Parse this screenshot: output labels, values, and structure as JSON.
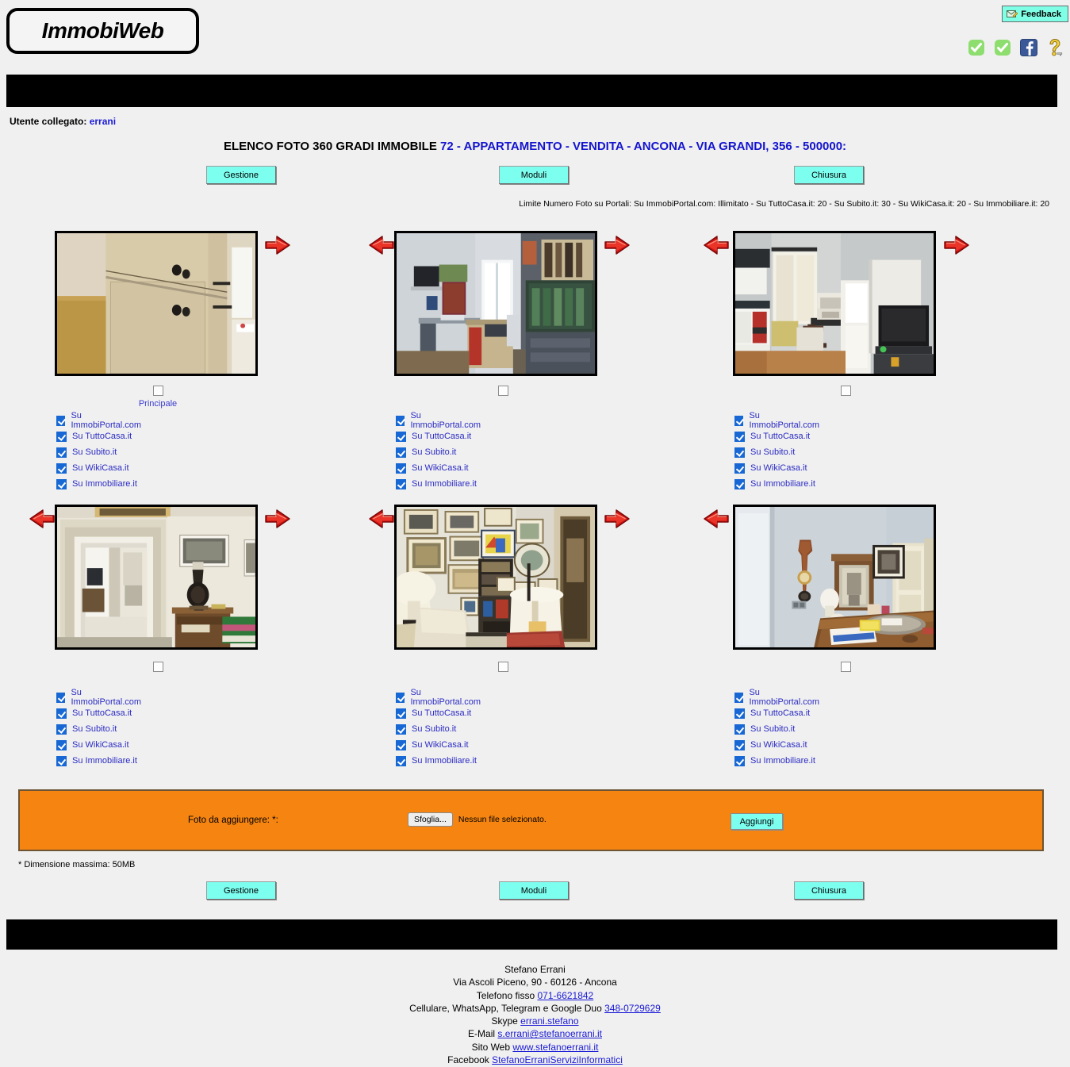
{
  "brand": {
    "logo_text": "ImmobiWeb"
  },
  "header": {
    "feedback_label": "Feedback",
    "feedback_icon": "envelope-pencil-icon",
    "status_icons": [
      "green-check-icon",
      "green-check-icon",
      "facebook-icon",
      "help-key-icon"
    ]
  },
  "user": {
    "prefix": "Utente collegato:",
    "name": "errani"
  },
  "title": {
    "static": "ELENCO FOTO 360 GRADI IMMOBILE ",
    "highlight": "72 - APPARTAMENTO - VENDITA - ANCONA - VIA GRANDI, 356 - 500000:"
  },
  "toolbar": {
    "gestione_label": "Gestione",
    "moduli_label": "Moduli",
    "chiusura_label": "Chiusura"
  },
  "limit_note": "Limite Numero Foto su Portali:  Su ImmobiPortal.com: Illimitato - Su TuttoCasa.it: 20 -  Su  Subito.it: 30 -  Su WikiCasa.it: 20 - Su Immobiliare.it: 20",
  "portals": [
    "Su ImmobiPortal.com",
    "Su TuttoCasa.it",
    "Su Subito.it",
    "Su WikiCasa.it",
    "Su Immobiliare.it"
  ],
  "principale_label": "Principale",
  "photos": [
    {
      "alt": "Armadio a muro con ante chiare",
      "principale_checked": false,
      "show_principale_label": true,
      "left_arrow": false,
      "right_arrow": true,
      "portal_checked": [
        true,
        true,
        true,
        true,
        true
      ]
    },
    {
      "alt": "Studio con scrivania e libreria",
      "principale_checked": false,
      "show_principale_label": false,
      "left_arrow": true,
      "right_arrow": true,
      "portal_checked": [
        true,
        true,
        true,
        true,
        true
      ]
    },
    {
      "alt": "Cucina con finestra e televisore",
      "principale_checked": false,
      "show_principale_label": false,
      "left_arrow": true,
      "right_arrow": true,
      "portal_checked": [
        true,
        true,
        true,
        true,
        true
      ]
    },
    {
      "alt": "Corridoio con porta e lampada",
      "principale_checked": false,
      "show_principale_label": false,
      "left_arrow": true,
      "right_arrow": true,
      "portal_checked": [
        true,
        true,
        true,
        true,
        true
      ]
    },
    {
      "alt": "Soggiorno con quadri e poltrona",
      "principale_checked": false,
      "show_principale_label": false,
      "left_arrow": true,
      "right_arrow": true,
      "portal_checked": [
        true,
        true,
        true,
        true,
        true
      ]
    },
    {
      "alt": "Camera con comò e barometro",
      "principale_checked": false,
      "show_principale_label": false,
      "left_arrow": true,
      "right_arrow": false,
      "portal_checked": [
        true,
        true,
        true,
        true,
        true
      ]
    }
  ],
  "upload": {
    "label": "Foto da aggiungere: *:",
    "browse_label": "Sfoglia...",
    "no_file_text": "Nessun file selezionato.",
    "add_label": "Aggiungi",
    "max_size_note": "* Dimensione massima: 50MB"
  },
  "footer": {
    "name": "Stefano Errani",
    "address": "Via Ascoli Piceno, 90 - 60126 - Ancona",
    "phone_label": "Telefono fisso",
    "phone": "071-6621842",
    "mobile_label": "Cellulare, WhatsApp, Telegram e Google Duo",
    "mobile": "348-0729629",
    "skype_label": "Skype",
    "skype": "errani.stefano",
    "email_label": "E-Mail",
    "email": "s.errani@stefanoerrani.it",
    "web_label": "Sito Web",
    "web": "www.stefanoerrani.it",
    "facebook_label": "Facebook",
    "facebook": "StefanoErraniServiziInformatici"
  },
  "colors": {
    "page_bg": "#f0f0f0",
    "button_cyan": "#7dfff0",
    "upload_orange": "#f58410",
    "link_blue": "#1a1ad6",
    "checkbox_blue": "#1768d4",
    "arrow_red": "#d61212"
  }
}
